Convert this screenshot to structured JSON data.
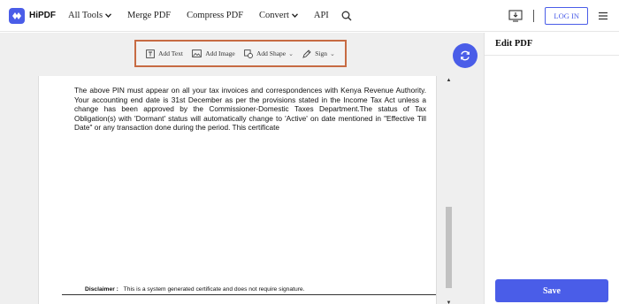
{
  "app": {
    "logo_text": "HiPDF"
  },
  "nav": {
    "items": [
      {
        "label": "All Tools",
        "has_caret": true
      },
      {
        "label": "Merge PDF",
        "has_caret": false
      },
      {
        "label": "Compress PDF",
        "has_caret": false
      },
      {
        "label": "Convert",
        "has_caret": true
      },
      {
        "label": "API",
        "has_caret": false
      }
    ],
    "search_icon": "search-icon",
    "login_label": "LOG IN",
    "download_icon": "download-desktop-icon",
    "menu_icon": "hamburger-menu-icon"
  },
  "toolbar": {
    "add_text": "Add Text",
    "add_image": "Add Image",
    "add_shape": "Add Shape",
    "sign": "Sign"
  },
  "document": {
    "body_text": "The above PIN must appear on all your tax invoices and correspondences with Kenya Revenue Authority. Your accounting end date is 31st December as per the provisions stated in the Income Tax Act unless a change has been approved by the Commissioner-Domestic Taxes Department.The status of Tax Obligation(s) with 'Dormant' status will automatically change to 'Active' on date mentioned in \"Effective Till Date\" or any transaction done during the period. This certificate",
    "disclaimer_label": "Disclaimer :",
    "disclaimer_text": "This is a system generated certificate and does not require signature."
  },
  "panel": {
    "title": "Edit PDF",
    "save_label": "Save"
  },
  "colors": {
    "accent": "#4a5de8",
    "toolbar_highlight": "#c76b43",
    "editor_bg": "#efefef"
  }
}
